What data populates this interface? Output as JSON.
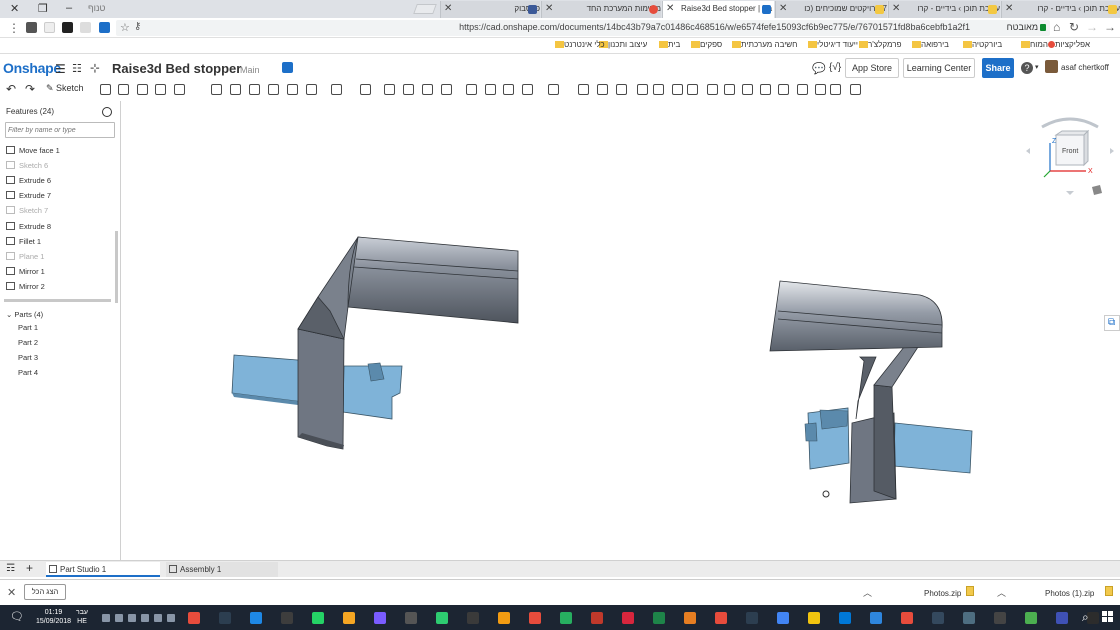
{
  "browser": {
    "profile_name": "טנוף",
    "tabs": [
      {
        "title": "עריכת תוכן › בידיים - קרו",
        "fav_color": "#f3c842",
        "active": false
      },
      {
        "title": "עריכת תוכן › בידיים - קרו",
        "fav_color": "#f3c842",
        "active": false
      },
      {
        "title": "7 פרויקטים שמוכיחים (כו",
        "fav_color": "#f3c842",
        "active": false
      },
      {
        "title": "Raise3d Bed stopper | Pa",
        "fav_color": "#1d6fc8",
        "active": true
      },
      {
        "title": "משימות המערכת החד",
        "fav_color": "#e64c3c",
        "active": false
      },
      {
        "title": "פייסבוק",
        "fav_color": "#3b5998",
        "active": false
      }
    ],
    "url": "https://cad.onshape.com/documents/14bc43b79a7c01486c468516/w/e6574fefe15093cf6b9ec775/e/76701571fd8ba6cebfb1a2f1",
    "security_label": "מאובטח",
    "bookmarks": [
      "אפליקציות",
      "המוח",
      "ביורקטיה",
      "בירפואה",
      "פרמקלצ'ר",
      "ייעוד דיגיטלי",
      "חשיבה מערכתית",
      "ספקים",
      "בית",
      "עיצוב ותכנון",
      "כלי אינטרנט"
    ]
  },
  "onshape": {
    "logo": "Onshape",
    "doc_title": "Raise3d Bed stopper",
    "workspace": "Main",
    "app_store": "App Store",
    "learning_center": "Learning Center",
    "share": "Share",
    "help": "?",
    "user": "asaf chertkoff",
    "sketch_label": "Sketch"
  },
  "features": {
    "title": "Features (24)",
    "filter_placeholder": "Filter by name or type",
    "items": [
      {
        "label": "Move face 1",
        "dim": false
      },
      {
        "label": "Sketch 6",
        "dim": true
      },
      {
        "label": "Extrude 6",
        "dim": false
      },
      {
        "label": "Extrude 7",
        "dim": false
      },
      {
        "label": "Sketch 7",
        "dim": true
      },
      {
        "label": "Extrude 8",
        "dim": false
      },
      {
        "label": "Fillet 1",
        "dim": false
      },
      {
        "label": "Plane 1",
        "dim": true
      },
      {
        "label": "Mirror 1",
        "dim": false
      },
      {
        "label": "Mirror 2",
        "dim": false
      }
    ],
    "parts_header": "Parts (4)",
    "parts": [
      "Part 1",
      "Part 2",
      "Part 3",
      "Part 4"
    ]
  },
  "viewcube": {
    "face": "Front",
    "axis_z": "Z",
    "axis_x": "X"
  },
  "bottom_tabs": [
    "Part Studio 1",
    "Assembly 1"
  ],
  "downloads": {
    "show_all": "הצג הכל",
    "items": [
      "Photos.zip",
      "Photos (1).zip"
    ]
  },
  "taskbar": {
    "time": "01:19",
    "date": "15/09/2018",
    "lang_top": "עבר",
    "lang_bottom": "HE"
  },
  "colors": {
    "brand": "#1d6fc8",
    "part_gray": "#6f7682",
    "part_blue": "#7fb3d8"
  }
}
